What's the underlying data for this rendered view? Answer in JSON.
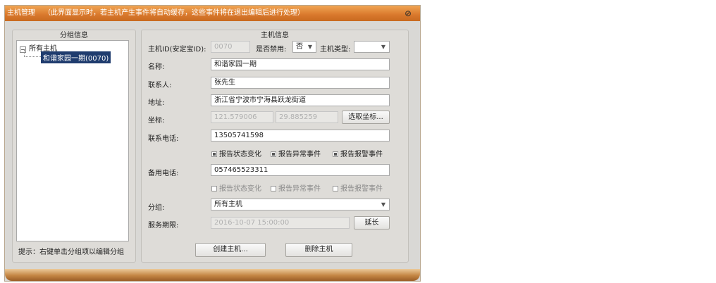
{
  "window": {
    "title": "主机管理",
    "title_note": "（此界面显示时，若主机产生事件将自动缓存，这些事件将在退出编辑后进行处理）"
  },
  "group_panel": {
    "title": "分组信息",
    "tree_root": "所有主机",
    "tree_child": "和谐家园一期(0070)",
    "hint": "提示：右键单击分组项以编辑分组"
  },
  "host_panel": {
    "title": "主机信息",
    "host_id_label": "主机ID(安定宝ID):",
    "host_id_value": "0070",
    "disabled_label": "是否禁用:",
    "disabled_value": "否",
    "host_type_label": "主机类型:",
    "host_type_value": "",
    "name_label": "名称:",
    "name_value": "和谐家园一期",
    "contact_label": "联系人:",
    "contact_value": "张先生",
    "address_label": "地址:",
    "address_value": "浙江省宁波市宁海县跃龙街道",
    "coord_label": "坐标:",
    "coord_x": "121.579006",
    "coord_y": "29.885259",
    "pick_coord_button": "选取坐标...",
    "phone_label": "联系电话:",
    "phone_value": "13505741598",
    "phone_options": [
      {
        "label": "报告状态变化",
        "checked": true
      },
      {
        "label": "报告异常事件",
        "checked": true
      },
      {
        "label": "报告报警事件",
        "checked": true
      }
    ],
    "backup_phone_label": "备用电话:",
    "backup_phone_value": "057465523311",
    "backup_options": [
      {
        "label": "报告状态变化",
        "checked": false
      },
      {
        "label": "报告异常事件",
        "checked": false
      },
      {
        "label": "报告报警事件",
        "checked": false
      }
    ],
    "group_label": "分组:",
    "group_value": "所有主机",
    "service_label": "服务期限:",
    "service_value": "2016-10-07 15:00:00",
    "extend_button": "延长",
    "create_button": "创建主机...",
    "delete_button": "删除主机"
  },
  "colors": {
    "title_bar": "#d9782c",
    "tree_selection": "#1f3c6e",
    "window_bg": "#d9d8d5"
  }
}
